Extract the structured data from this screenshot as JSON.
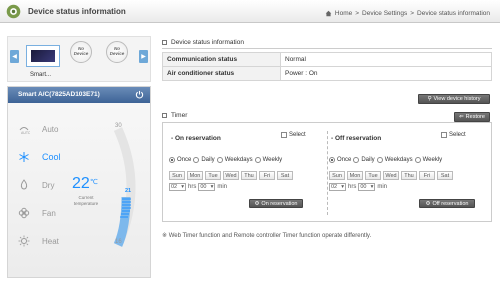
{
  "header": {
    "title": "Device status information",
    "breadcrumb": [
      "Home",
      "Device Settings",
      "Device status information"
    ],
    "sep": ">"
  },
  "devices": {
    "selected_label": "Smart...",
    "empty_slots": [
      {
        "line1": "No",
        "line2": "Device"
      },
      {
        "line1": "No",
        "line2": "Device"
      }
    ],
    "prev": "◀",
    "next": "▶"
  },
  "ac": {
    "title": "Smart A/C(7825AD103E71)",
    "modes": [
      {
        "name": "Auto",
        "icon": "auto-icon"
      },
      {
        "name": "Cool",
        "icon": "snowflake-icon"
      },
      {
        "name": "Dry",
        "icon": "drop-icon"
      },
      {
        "name": "Fan",
        "icon": "fan-icon"
      },
      {
        "name": "Heat",
        "icon": "sun-icon"
      }
    ],
    "active_mode": "Cool",
    "current_temp": "22",
    "temp_unit": "℃",
    "temp_caption_line1": "Current",
    "temp_caption_line2": "temperature",
    "scale_max": "30",
    "scale_min": "16",
    "setpoint": "21",
    "accent": "#1e90ff"
  },
  "status": {
    "section_title": "Device status information",
    "rows": [
      {
        "key": "Communication status",
        "value": "Normal"
      },
      {
        "key": "Air conditioner status",
        "value": "Power : On"
      }
    ],
    "history_button": "View device history"
  },
  "timer": {
    "section_title": "Timer",
    "restore_button": "Restore",
    "select_label": "Select",
    "recurrence": [
      "Once",
      "Daily",
      "Weekdays",
      "Weekly"
    ],
    "days": [
      "Sun",
      "Mon",
      "Tue",
      "Wed",
      "Thu",
      "Fri",
      "Sat"
    ],
    "hrs_label": "hrs",
    "min_label": "min",
    "on": {
      "title": "- On reservation",
      "hour": "02",
      "minute": "00",
      "button": "On reservation"
    },
    "off": {
      "title": "- Off reservation",
      "hour": "02",
      "minute": "00",
      "button": "Off reservation"
    }
  },
  "note": "※ Web Timer function and Remote controller Timer function operate differently."
}
